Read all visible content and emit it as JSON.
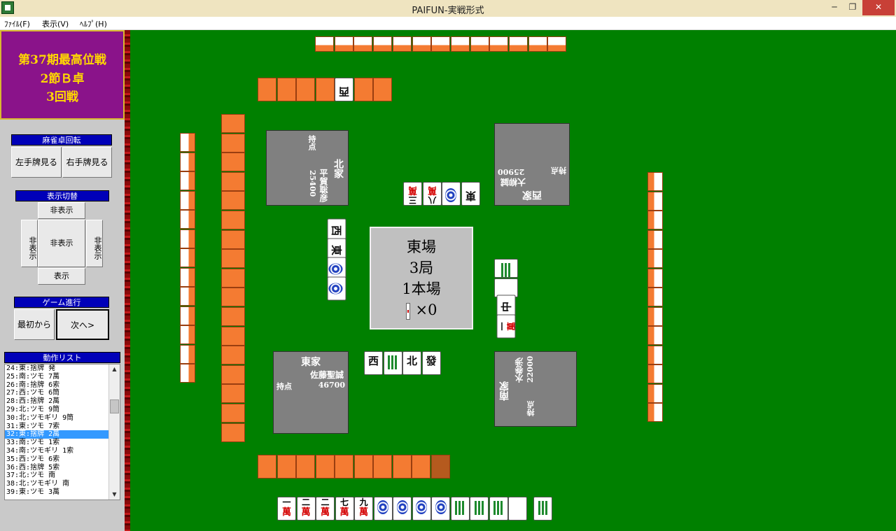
{
  "window": {
    "title": "PAIFUN-実戦形式",
    "minimize": "─",
    "maximize": "❐",
    "close": "✕"
  },
  "menu": [
    "ﾌｧｲﾙ(F)",
    "表示(V)",
    "ﾍﾙﾌﾟ(H)"
  ],
  "banner": {
    "line1": "第37期最高位戦",
    "line2": "2節Ｂ卓",
    "line3": "3回戦"
  },
  "rotate_panel": {
    "header": "麻雀卓回転",
    "left_button": "左手牌見る",
    "right_button": "右手牌見る"
  },
  "display_panel": {
    "header": "表示切替",
    "top": "非表示",
    "left": "非表示",
    "center": "非表示",
    "right": "非表示",
    "bottom": "表示"
  },
  "game_panel": {
    "header": "ゲーム進行",
    "first_button": "最初から",
    "next_button": "次へ>"
  },
  "action_list": {
    "header": "動作リスト",
    "selected_index": 8,
    "items": [
      "24:東:捨牌 発",
      "25:南:ツモ 7萬",
      "26:南:捨牌 6索",
      "27:西:ツモ 6筒",
      "28:西:捨牌 2萬",
      "29:北:ツモ 9筒",
      "30:北:ツモギリ 9筒",
      "31:東:ツモ 7索",
      "32:東:捨牌 2萬",
      "33:南:ツモ 1索",
      "34:南:ツモギリ 1索",
      "35:西:ツモ 6索",
      "36:西:捨牌 5索",
      "37:北:ツモ 南",
      "38:北:ツモギリ 南",
      "39:東:ツモ 3萬"
    ]
  },
  "center": {
    "round": "東場",
    "hand": "3局",
    "honba": "1本場",
    "riichi_sticks": "×0"
  },
  "players": {
    "east": {
      "seat": "東家",
      "name": "佐藤聖誠",
      "points_label": "持点",
      "points": "46700"
    },
    "south": {
      "seat": "南家",
      "name": "水巻渉",
      "points_label": "持点",
      "points": "22000"
    },
    "west": {
      "seat": "西家",
      "name": "大柳誠",
      "points_label": "持点",
      "points": "25900"
    },
    "north": {
      "seat": "北家",
      "name": "平賀聡彦",
      "points_label": "持点",
      "points": "25400"
    }
  },
  "hand_east": [
    {
      "n": "一",
      "k": "萬"
    },
    {
      "n": "二",
      "k": "萬"
    },
    {
      "n": "二",
      "k": "萬"
    },
    {
      "n": "七",
      "k": "萬"
    },
    {
      "n": "九",
      "k": "萬"
    },
    {
      "type": "pin"
    },
    {
      "type": "pin"
    },
    {
      "type": "pin"
    },
    {
      "type": "pin"
    },
    {
      "type": "sou"
    },
    {
      "type": "sou"
    },
    {
      "type": "sou"
    },
    {
      "type": "blank"
    }
  ],
  "drawn_tile": {
    "type": "sou"
  },
  "east_discards": [
    "西",
    "",
    "北",
    "發"
  ],
  "south_discards": [
    "",
    "",
    "中",
    "一萬"
  ],
  "west_discards": [
    "東",
    "",
    "八萬",
    "三萬"
  ],
  "north_discards": [
    "西",
    "東",
    "",
    ""
  ],
  "north_wall_flipped": "西"
}
